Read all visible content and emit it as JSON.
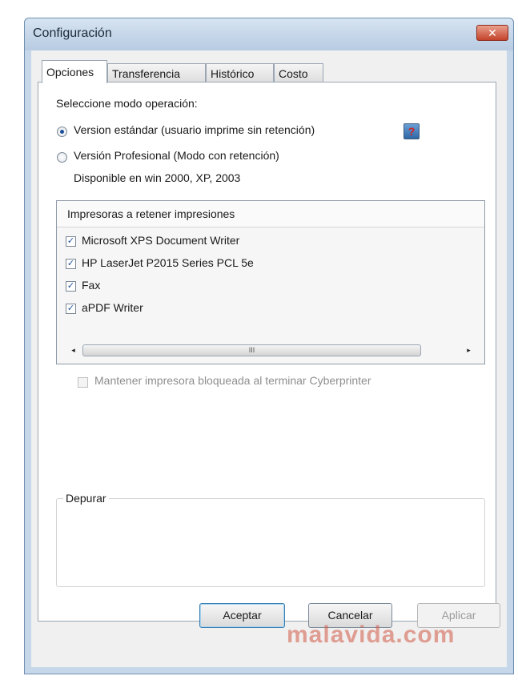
{
  "window": {
    "title": "Configuración",
    "close_glyph": "✕"
  },
  "tabs": [
    {
      "label": "Opciones",
      "active": true
    },
    {
      "label": "Transferencia",
      "active": false
    },
    {
      "label": "Histórico",
      "active": false
    },
    {
      "label": "Costo",
      "active": false
    }
  ],
  "options": {
    "mode_label": "Seleccione modo operación:",
    "radio_standard": "Version estándar (usuario imprime sin retención)",
    "radio_professional": "Versión Profesional (Modo con retención)",
    "availability": "Disponible en win 2000, XP, 2003",
    "selected_mode": "standard",
    "help_icon": "help-icon",
    "help_glyph": "?"
  },
  "printers": {
    "header": "Impresoras a retener impresiones",
    "items": [
      {
        "name": "Microsoft XPS Document Writer",
        "checked": true
      },
      {
        "name": "HP LaserJet P2015 Series PCL 5e",
        "checked": true
      },
      {
        "name": "Fax",
        "checked": true
      },
      {
        "name": "aPDF Writer",
        "checked": true
      }
    ],
    "scroll_left": "◂",
    "scroll_right": "▸",
    "scroll_grip": "III"
  },
  "keep_locked": {
    "label": "Mantener impresora bloqueada al terminar Cyberprinter",
    "checked": false,
    "enabled": false
  },
  "debug": {
    "label": "Depurar"
  },
  "buttons": {
    "accept": "Aceptar",
    "cancel": "Cancelar",
    "apply": "Aplicar"
  },
  "check_glyph": "✓",
  "watermark": "malavida.com"
}
